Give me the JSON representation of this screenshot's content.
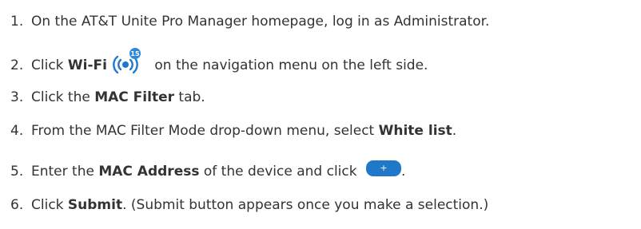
{
  "steps": [
    {
      "number": "1.",
      "text": "On the AT&T Unite Pro Manager homepage, log in as Administrator."
    },
    {
      "number": "2.",
      "pre": "Click ",
      "bold": "Wi-Fi",
      "icon": "wifi-icon",
      "icon_badge": "15",
      "post": " on the navigation menu on the left side."
    },
    {
      "number": "3.",
      "pre": "Click the ",
      "bold": "MAC Filter",
      "post": " tab."
    },
    {
      "number": "4.",
      "pre": "From the MAC Filter Mode drop-down menu, select ",
      "bold": "White list",
      "post": "."
    },
    {
      "number": "5.",
      "pre": "Enter the ",
      "bold": "MAC Address",
      "mid": " of the device and click ",
      "button_icon": "plus-icon",
      "button_label": "+",
      "post": "."
    },
    {
      "number": "6.",
      "pre": "Click ",
      "bold": "Submit",
      "post": ". (Submit button appears once you make a selection.)"
    }
  ],
  "colors": {
    "text": "#333333",
    "accent_blue": "#1f78c8",
    "badge_blue": "#2e8ad8"
  }
}
